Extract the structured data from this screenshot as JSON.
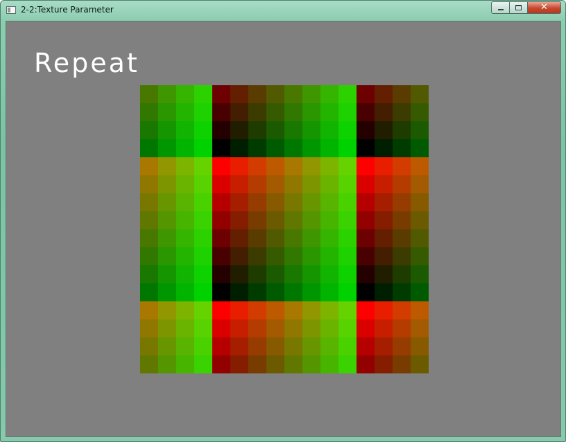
{
  "window": {
    "title": "2-2:Texture Parameter",
    "controls": {
      "minimize_icon": "minimize-icon",
      "maximize_icon": "maximize-icon",
      "close_icon": "close-icon",
      "close_glyph": "✕"
    }
  },
  "canvas": {
    "background": "#808080",
    "caption": "Repeat",
    "texture": {
      "wrap_mode": "repeat",
      "columns": 16,
      "rows": 16,
      "palette_note_colors": {
        "red_axis": "columns",
        "green_axis": "rows"
      }
    }
  }
}
